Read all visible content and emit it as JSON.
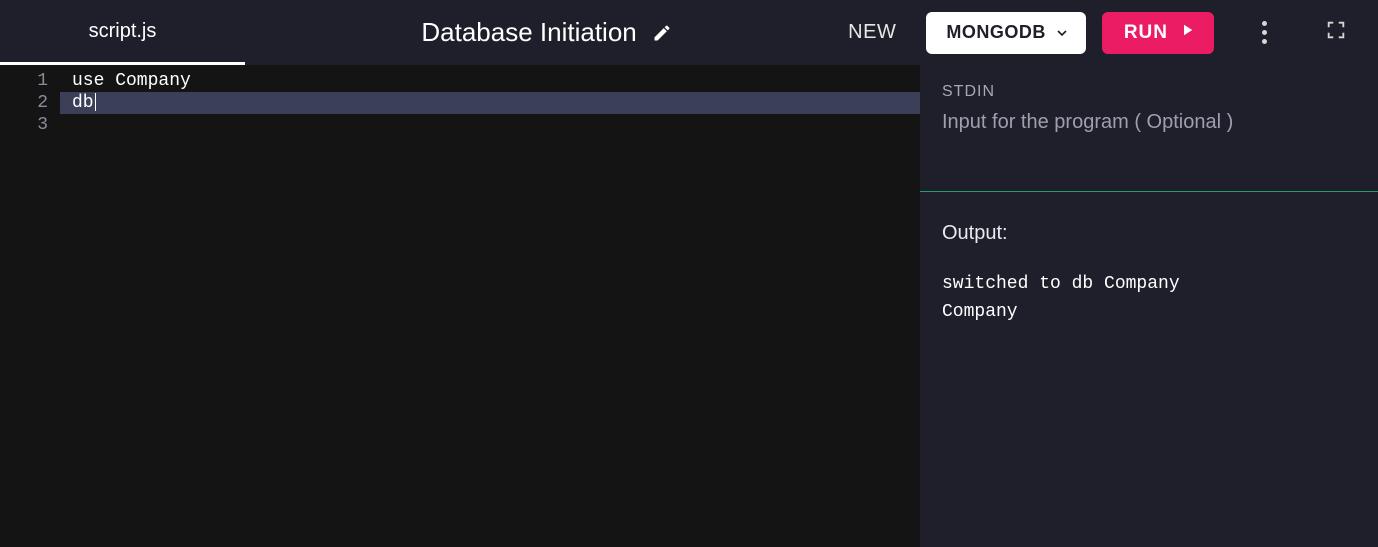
{
  "header": {
    "tab": "script.js",
    "title": "Database Initiation",
    "new_label": "NEW",
    "lang_label": "MONGODB",
    "run_label": "RUN"
  },
  "editor": {
    "lines": [
      {
        "n": "1",
        "text": "use Company",
        "active": false
      },
      {
        "n": "2",
        "text": "db",
        "active": true
      },
      {
        "n": "3",
        "text": "",
        "active": false
      }
    ]
  },
  "panel": {
    "stdin_label": "STDIN",
    "stdin_placeholder": "Input for the program ( Optional )",
    "stdin_value": "",
    "output_label": "Output:",
    "output_text": "switched to db Company\nCompany"
  },
  "colors": {
    "accent_run": "#ec1c64",
    "panel_bg": "#1e1f2a",
    "editor_bg": "#141414",
    "active_line": "#3b3f57",
    "divider": "#22a06b"
  }
}
